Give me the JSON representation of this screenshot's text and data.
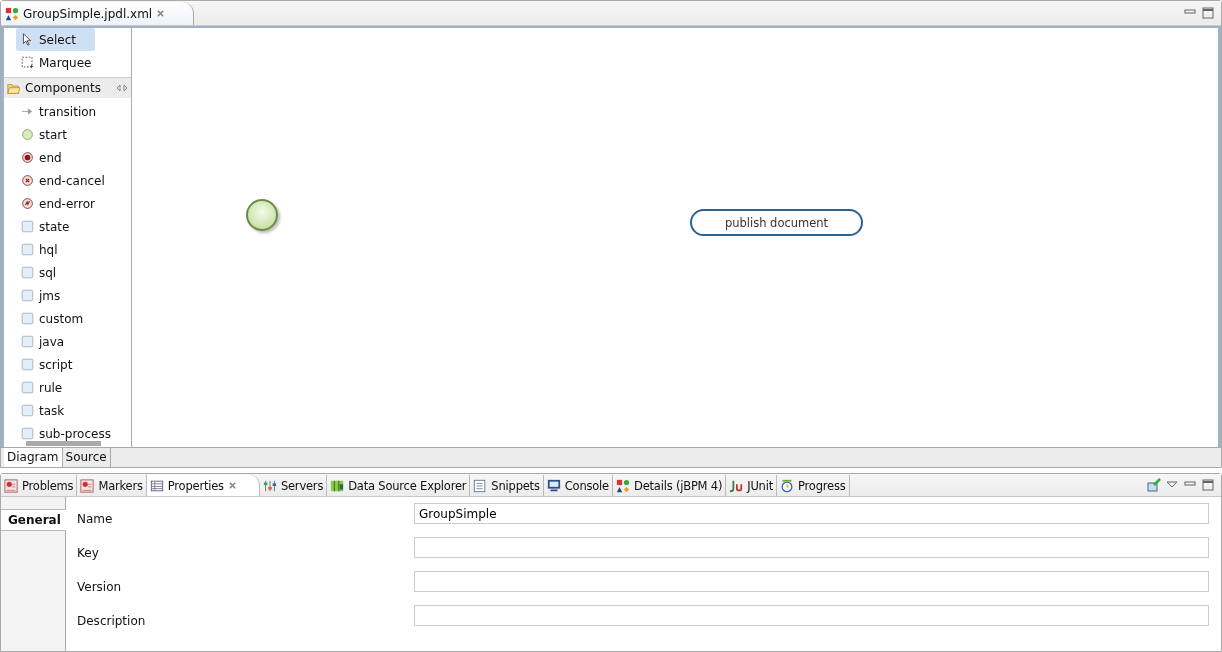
{
  "editor": {
    "tab": {
      "title": "GroupSimple.jpdl.xml",
      "selected": true
    },
    "palette": {
      "tools": [
        {
          "label": "Select",
          "kind": "pointer",
          "selected": true
        },
        {
          "label": "Marquee",
          "kind": "marquee",
          "selected": false
        }
      ],
      "drawer": {
        "label": "Components",
        "expanded": true,
        "items": [
          {
            "label": "transition",
            "kind": "arrow"
          },
          {
            "label": "start",
            "kind": "start"
          },
          {
            "label": "end",
            "kind": "end"
          },
          {
            "label": "end-cancel",
            "kind": "end-cancel"
          },
          {
            "label": "end-error",
            "kind": "end-error"
          },
          {
            "label": "state",
            "kind": "box"
          },
          {
            "label": "hql",
            "kind": "box"
          },
          {
            "label": "sql",
            "kind": "box"
          },
          {
            "label": "jms",
            "kind": "box"
          },
          {
            "label": "custom",
            "kind": "box"
          },
          {
            "label": "java",
            "kind": "box"
          },
          {
            "label": "script",
            "kind": "box"
          },
          {
            "label": "rule",
            "kind": "box"
          },
          {
            "label": "task",
            "kind": "box"
          },
          {
            "label": "sub-process",
            "kind": "box"
          }
        ]
      }
    },
    "canvas": {
      "nodes": [
        {
          "kind": "start"
        },
        {
          "kind": "task",
          "label": "publish document"
        }
      ]
    },
    "bottom_tabs": [
      {
        "label": "Diagram",
        "selected": true
      },
      {
        "label": "Source",
        "selected": false
      }
    ]
  },
  "views": {
    "tabs": [
      {
        "label": "Problems",
        "kind": "problems",
        "selected": false
      },
      {
        "label": "Markers",
        "kind": "problems",
        "selected": false
      },
      {
        "label": "Properties",
        "kind": "table",
        "selected": true
      },
      {
        "label": "Servers",
        "kind": "servers",
        "selected": false
      },
      {
        "label": "Data Source Explorer",
        "kind": "datasource",
        "selected": false
      },
      {
        "label": "Snippets",
        "kind": "snippets",
        "selected": false
      },
      {
        "label": "Console",
        "kind": "console",
        "selected": false
      },
      {
        "label": "Details (jBPM 4)",
        "kind": "shapes",
        "selected": false
      },
      {
        "label": "JUnit",
        "kind": "junit",
        "selected": false
      },
      {
        "label": "Progress",
        "kind": "progress",
        "selected": false
      }
    ],
    "sections": [
      {
        "label": "General",
        "selected": true
      }
    ],
    "fields": [
      {
        "label": "Name",
        "value": "GroupSimple"
      },
      {
        "label": "Key"
      },
      {
        "label": "Version"
      },
      {
        "label": "Description"
      }
    ]
  }
}
